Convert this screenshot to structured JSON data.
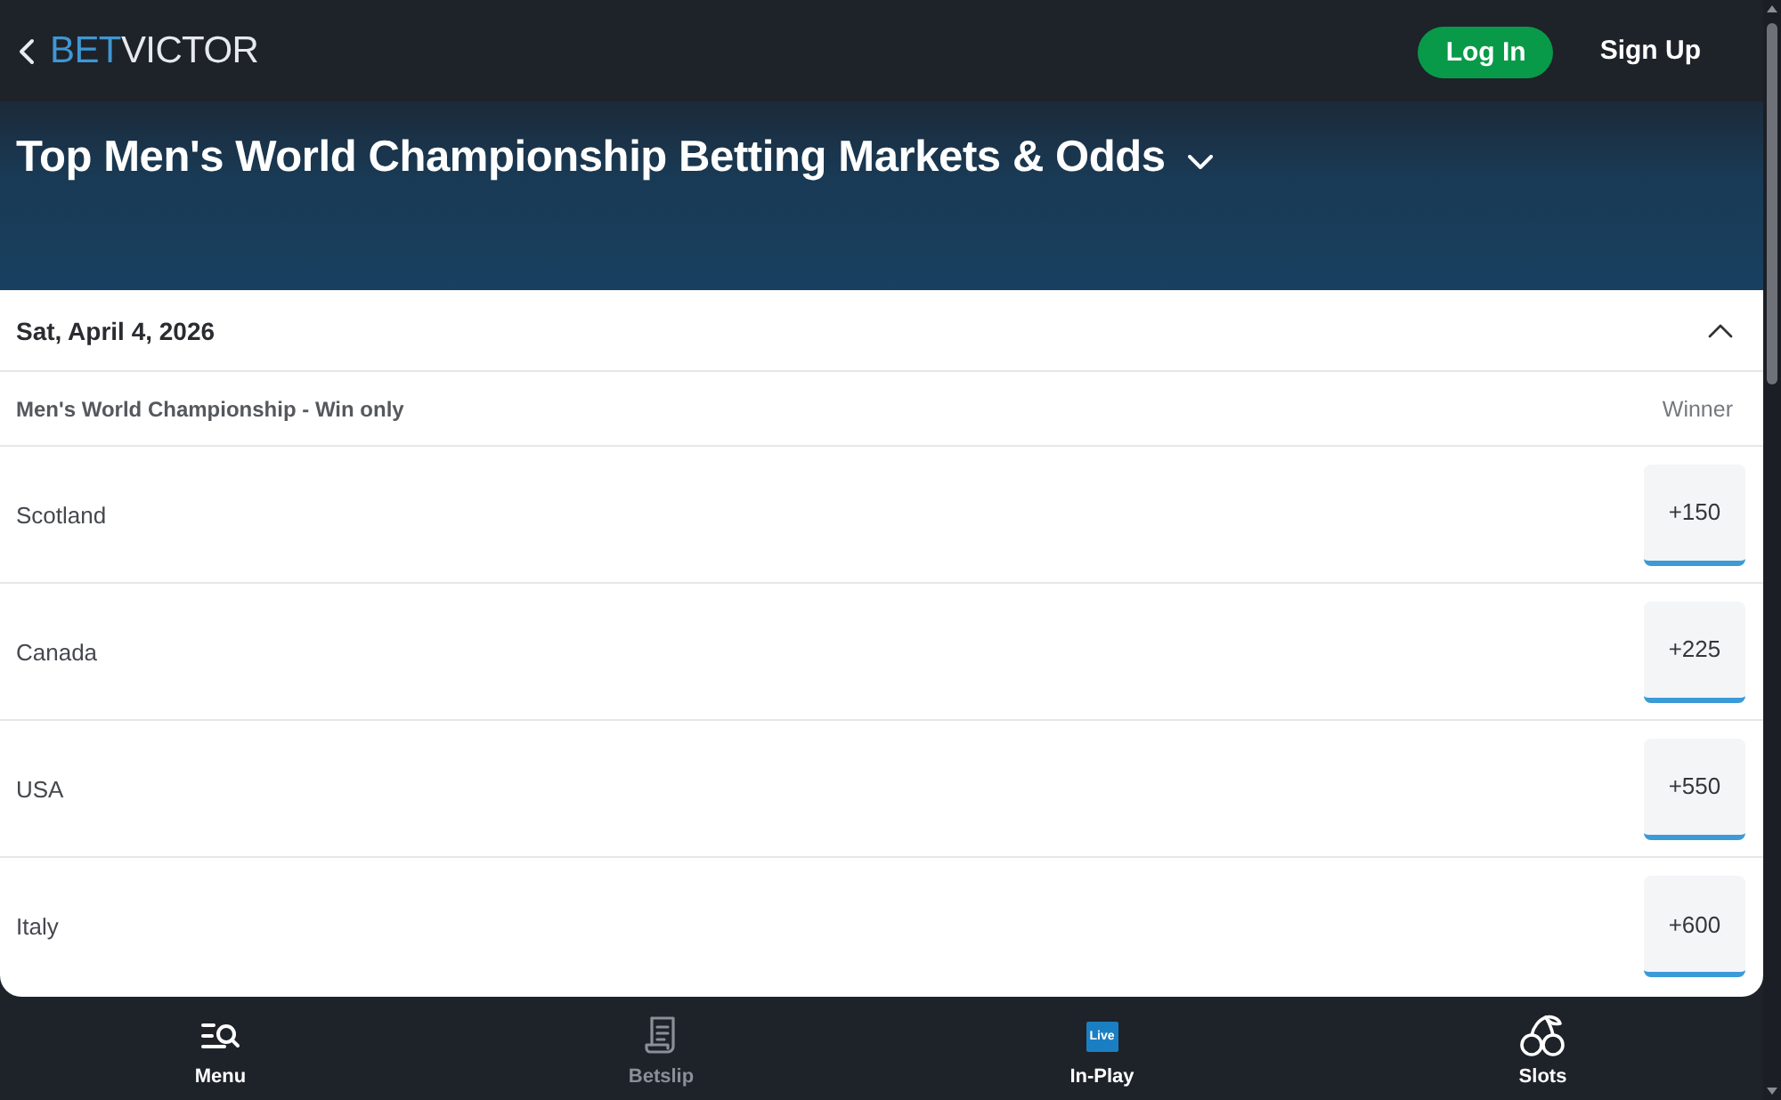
{
  "header": {
    "logo": [
      "BET",
      "VICTOR"
    ],
    "login_button": "Log In",
    "signup_link": "Sign Up"
  },
  "hero": {
    "title": "Top Men's World Championship Betting Markets & Odds"
  },
  "event": {
    "date": "Sat, April 4, 2026",
    "expanded": true,
    "market": "Men's World Championship - Win only",
    "column_header": "Winner",
    "selections": [
      {
        "name": "Scotland",
        "odds": "+150"
      },
      {
        "name": "Canada",
        "odds": "+225"
      },
      {
        "name": "USA",
        "odds": "+550"
      },
      {
        "name": "Italy",
        "odds": "+600"
      }
    ]
  },
  "bottom_nav": [
    {
      "label": "Menu",
      "kind": "menu",
      "disabled": false
    },
    {
      "label": "Betslip",
      "kind": "betslip",
      "disabled": true
    },
    {
      "label": "In-Play",
      "kind": "live",
      "badge": "Live",
      "disabled": false
    },
    {
      "label": "Slots",
      "kind": "slots",
      "disabled": false
    }
  ]
}
